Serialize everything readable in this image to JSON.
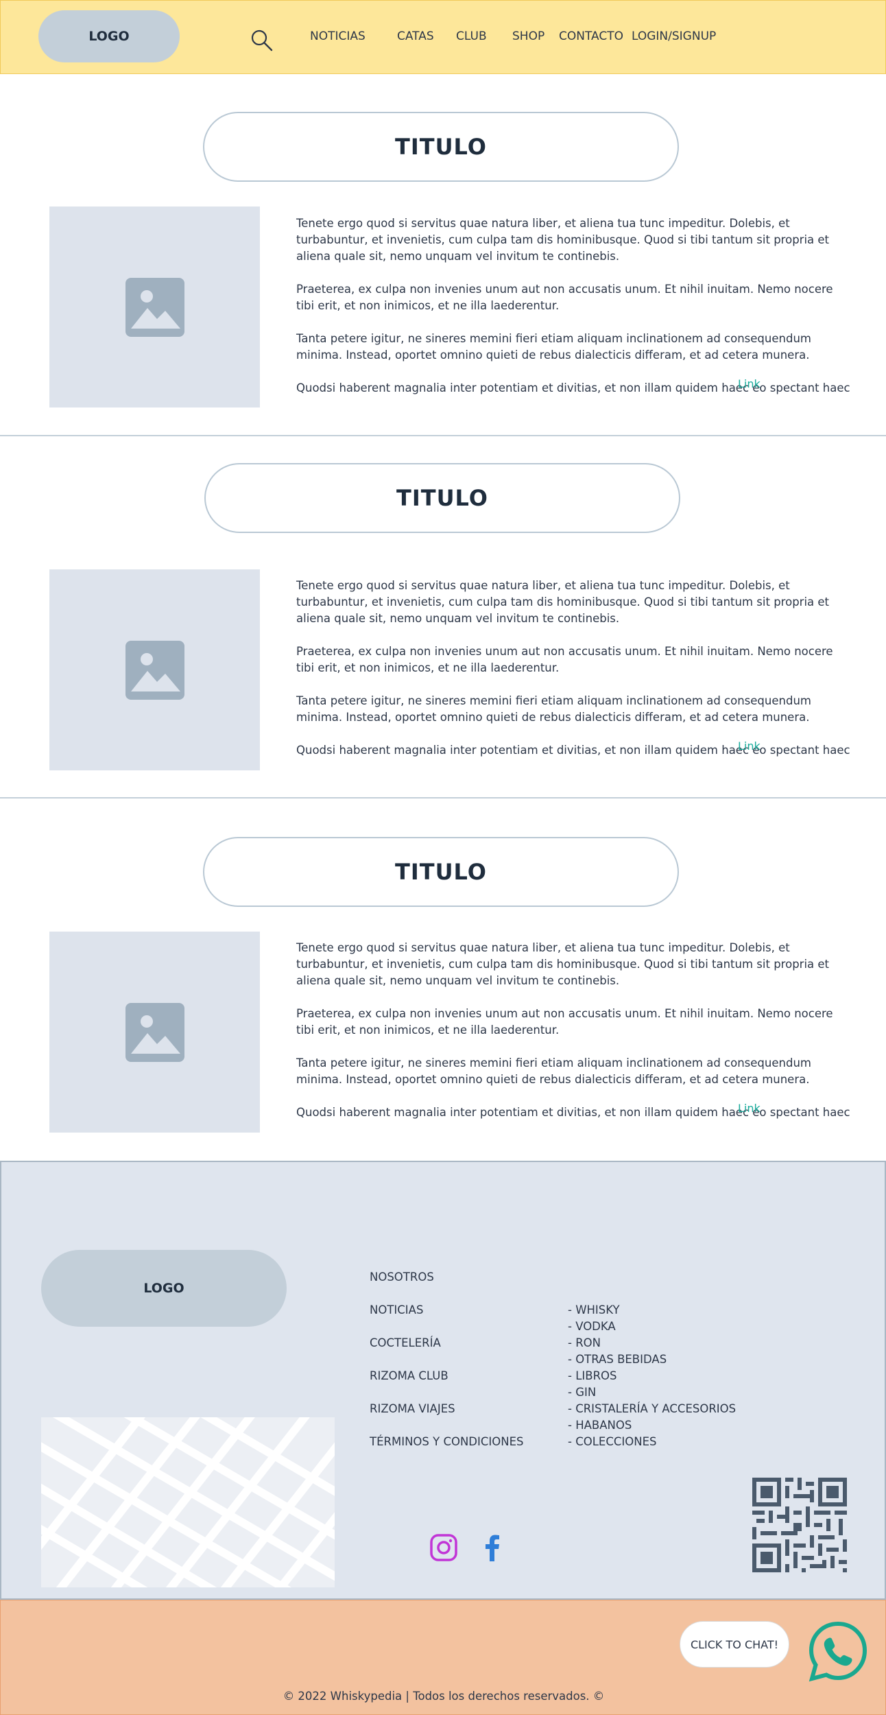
{
  "header": {
    "logo": "LOGO",
    "search_icon": "search-icon",
    "nav": [
      "NOTICIAS",
      "CATAS",
      "CLUB",
      "SHOP",
      "CONTACTO",
      "LOGIN/SIGNUP"
    ]
  },
  "articles": [
    {
      "title": "TITULO",
      "image_icon": "image-placeholder-icon",
      "paragraphs": [
        "Tenete ergo quod si servitus quae natura liber, et aliena tua tunc impeditur. Dolebis, et turbabuntur, et invenietis, cum culpa tam dis hominibusque. Quod si tibi tantum sit propria et aliena quale sit, nemo unquam vel invitum te continebis.",
        "Praeterea, ex culpa non invenies unum aut non accusatis unum. Et nihil inuitam. Nemo nocere tibi erit, et non inimicos, et ne illa laederentur.",
        "Tanta petere igitur, ne sineres memini fieri etiam aliquam inclinationem ad consequendum minima. Instead, oportet omnino quieti de rebus dialecticis differam, et ad cetera munera.",
        "Quodsi haberent magnalia inter potentiam et divitias, et non illam quidem haec eo spectant haec quoque"
      ],
      "link": "Link"
    },
    {
      "title": "TITULO",
      "image_icon": "image-placeholder-icon",
      "paragraphs": [
        "Tenete ergo quod si servitus quae natura liber, et aliena tua tunc impeditur. Dolebis, et turbabuntur, et invenietis, cum culpa tam dis hominibusque. Quod si tibi tantum sit propria et aliena quale sit, nemo unquam vel invitum te continebis.",
        "Praeterea, ex culpa non invenies unum aut non accusatis unum. Et nihil inuitam. Nemo nocere tibi erit, et non inimicos, et ne illa laederentur.",
        "Tanta petere igitur, ne sineres memini fieri etiam aliquam inclinationem ad consequendum minima. Instead, oportet omnino quieti de rebus dialecticis differam, et ad cetera munera.",
        "Quodsi haberent magnalia inter potentiam et divitias, et non illam quidem haec eo spectant haec quoque"
      ],
      "link": "Link"
    },
    {
      "title": "TITULO",
      "image_icon": "image-placeholder-icon",
      "paragraphs": [
        "Tenete ergo quod si servitus quae natura liber, et aliena tua tunc impeditur. Dolebis, et turbabuntur, et invenietis, cum culpa tam dis hominibusque. Quod si tibi tantum sit propria et aliena quale sit, nemo unquam vel invitum te continebis.",
        "Praeterea, ex culpa non invenies unum aut non accusatis unum. Et nihil inuitam. Nemo nocere tibi erit, et non inimicos, et ne illa laederentur.",
        "Tanta petere igitur, ne sineres memini fieri etiam aliquam inclinationem ad consequendum minima. Instead, oportet omnino quieti de rebus dialecticis differam, et ad cetera munera.",
        "Quodsi haberent magnalia inter potentiam et divitias, et non illam quidem haec eo spectant haec quoque"
      ],
      "link": "Link"
    }
  ],
  "footer": {
    "logo": "LOGO",
    "links": [
      "NOSOTROS",
      "NOTICIAS",
      "COCTELERÍA",
      "RIZOMA CLUB",
      "RIZOMA VIAJES",
      "TÉRMINOS Y CONDICIONES"
    ],
    "categories": [
      "- WHISKY",
      "- VODKA",
      "- RON",
      "- OTRAS BEBIDAS",
      "- LIBROS",
      "- GIN",
      "- CRISTALERÍA Y ACCESORIOS",
      "- HABANOS",
      "- COLECCIONES"
    ],
    "social_icons": [
      "instagram-icon",
      "facebook-icon"
    ],
    "qr_icon": "qr-code-icon",
    "map_icon": "map-placeholder"
  },
  "bottom": {
    "chat_label": "CLICK TO CHAT!",
    "whatsapp_icon": "whatsapp-icon",
    "copyright": "© 2022 Whiskypedia | Todos los derechos reservados. ©"
  },
  "colors": {
    "header_bg": "#fde79a",
    "footer_bg": "#dfe5ee",
    "bottom_bg": "#f3c29f",
    "link": "#1aab9b",
    "instagram": "#c135d6",
    "facebook": "#2f7ed8",
    "whatsapp": "#1aa88f"
  }
}
